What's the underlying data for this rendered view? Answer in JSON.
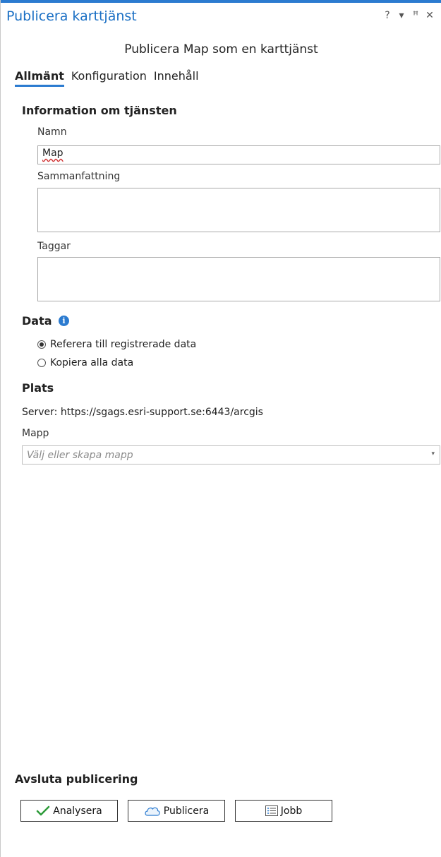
{
  "pane": {
    "title": "Publicera karttjänst",
    "subtitle": "Publicera Map som en karttjänst",
    "controls": {
      "help": "?",
      "menu": "▾",
      "pin": "ꟸ",
      "close": "✕"
    }
  },
  "tabs": [
    {
      "label": "Allmänt",
      "active": true
    },
    {
      "label": "Konfiguration",
      "active": false
    },
    {
      "label": "Innehåll",
      "active": false
    }
  ],
  "service_info": {
    "heading": "Information om tjänsten",
    "name_label": "Namn",
    "name_value": "Map",
    "summary_label": "Sammanfattning",
    "summary_value": "",
    "tags_label": "Taggar",
    "tags_value": ""
  },
  "data": {
    "heading": "Data",
    "info_icon": "i",
    "options": [
      {
        "label": "Referera till registrerade data",
        "selected": true
      },
      {
        "label": "Kopiera alla data",
        "selected": false
      }
    ]
  },
  "location": {
    "heading": "Plats",
    "server_text": "Server: https://sgags.esri-support.se:6443/arcgis",
    "folder_label": "Mapp",
    "folder_placeholder": "Välj eller skapa mapp",
    "dropdown_arrow": "▾"
  },
  "finish": {
    "heading": "Avsluta publicering",
    "buttons": {
      "analyze": "Analysera",
      "publish": "Publicera",
      "jobs": "Jobb"
    }
  },
  "colors": {
    "accent": "#2b7bd0",
    "title": "#1a6fc4",
    "check_green": "#2e9b3a"
  }
}
